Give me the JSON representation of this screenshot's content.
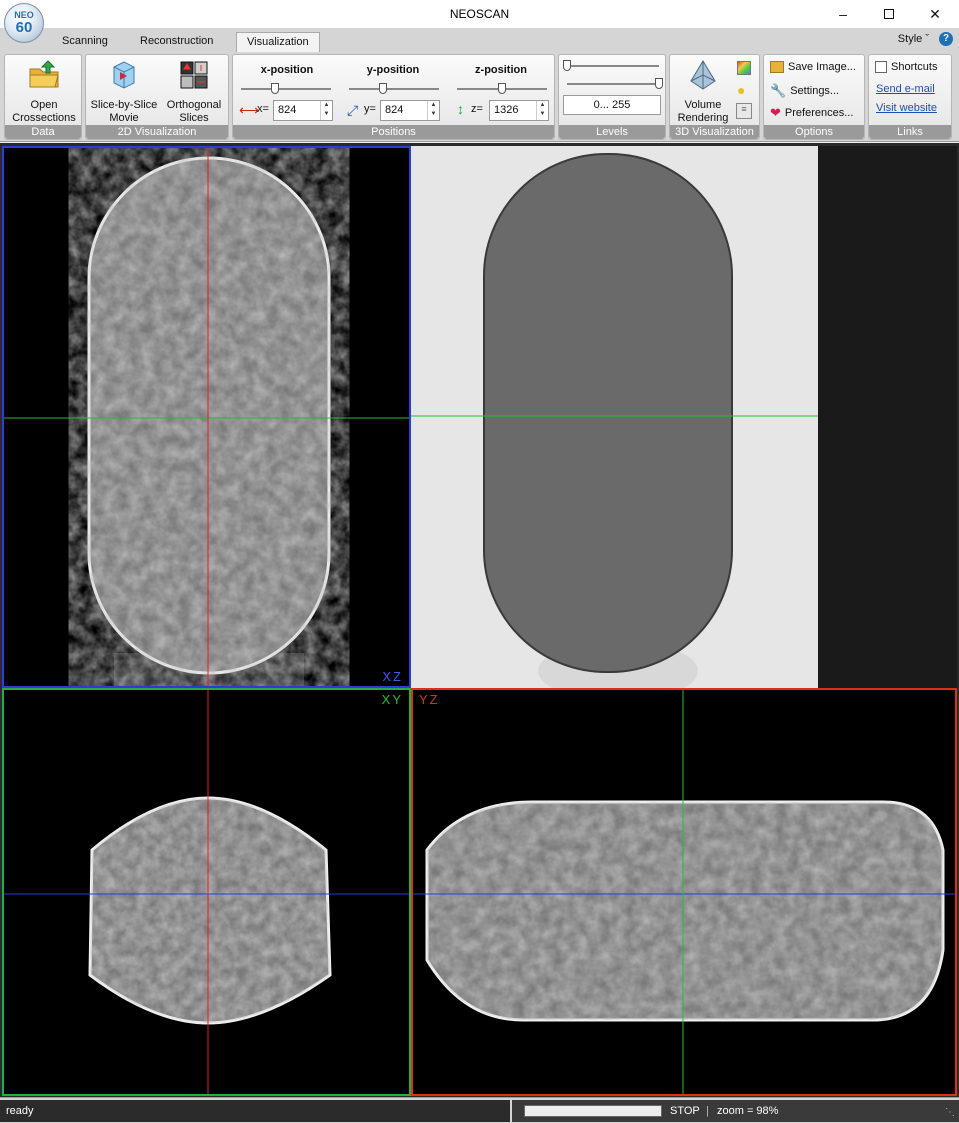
{
  "window": {
    "title": "NEOSCAN",
    "logo_top": "NEO",
    "logo_bottom": "60"
  },
  "tabs": [
    "Scanning",
    "Reconstruction",
    "Visualization"
  ],
  "style_label": "Style",
  "ribbon": {
    "data": {
      "caption": "Data",
      "open_label_1": "Open",
      "open_label_2": "Crossections"
    },
    "viz2d": {
      "caption": "2D Visualization",
      "movie_1": "Slice-by-Slice",
      "movie_2": "Movie",
      "ortho_1": "Orthogonal",
      "ortho_2": "Slices"
    },
    "positions": {
      "caption": "Positions",
      "x": {
        "title": "x-position",
        "label": "x=",
        "value": "824",
        "slider": 0.38
      },
      "y": {
        "title": "y-position",
        "label": "y=",
        "value": "824",
        "slider": 0.38
      },
      "z": {
        "title": "z-position",
        "label": "z=",
        "value": "1326",
        "slider": 0.5
      }
    },
    "levels": {
      "caption": "Levels",
      "range": "0... 255",
      "low": 0.0,
      "high": 1.0
    },
    "viz3d": {
      "caption": "3D Visualization",
      "vr_1": "Volume",
      "vr_2": "Rendering"
    },
    "options": {
      "caption": "Options",
      "save": "Save Image...",
      "settings": "Settings...",
      "prefs": "Preferences..."
    },
    "links": {
      "caption": "Links",
      "shortcuts": "Shortcuts",
      "email": "Send e-mail",
      "website": "Visit website"
    }
  },
  "views": {
    "xz": "XZ",
    "xy": "XY",
    "yz": "YZ"
  },
  "status": {
    "left": "ready",
    "stop": "STOP",
    "zoom": "zoom = 98%"
  }
}
